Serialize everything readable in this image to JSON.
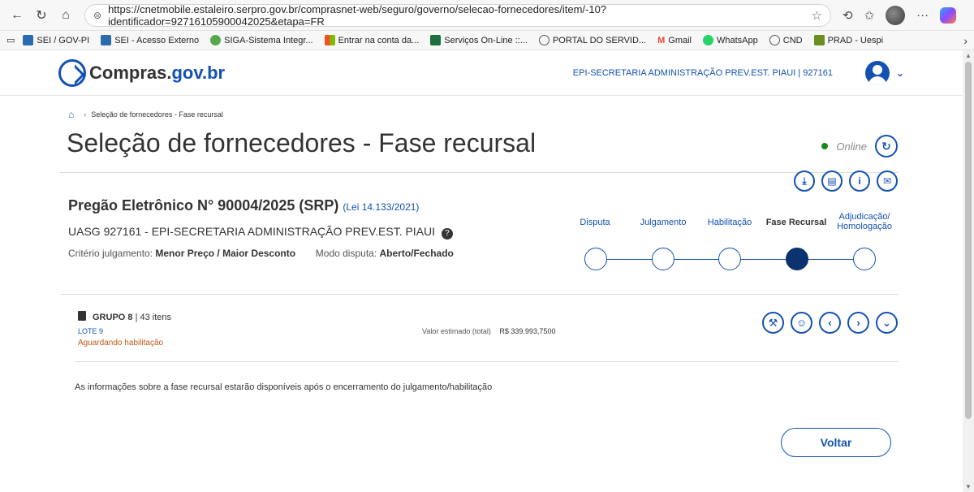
{
  "browser": {
    "url": "https://cnetmobile.estaleiro.serpro.gov.br/comprasnet-web/seguro/governo/selecao-fornecedores/item/-10?identificador=92716105900042025&etapa=FR",
    "bookmarks": [
      {
        "label": "SEI / GOV-PI",
        "color": "#2b6cb0"
      },
      {
        "label": "SEI - Acesso Externo",
        "color": "#2b6cb0"
      },
      {
        "label": "SIGA-Sistema Integr...",
        "color": "#56a84c"
      },
      {
        "label": "Entrar na conta da...",
        "color": "#f25022"
      },
      {
        "label": "Serviços On-Line ::...",
        "color": "#1f6e3d"
      },
      {
        "label": "PORTAL DO SERVID...",
        "color": "#555555"
      },
      {
        "label": "Gmail",
        "color": "#ea4335"
      },
      {
        "label": "WhatsApp",
        "color": "#25d366"
      },
      {
        "label": "CND",
        "color": "#555555"
      },
      {
        "label": "PRAD - Uespi",
        "color": "#6b8e23"
      }
    ]
  },
  "header": {
    "logo_main": "Compras.",
    "logo_gov": "gov.br",
    "org": "EPI-SECRETARIA ADMINISTRAÇÃO PREV.EST. PIAUI | 927161"
  },
  "breadcrumb": {
    "current": "Seleção de fornecedores - Fase recursal"
  },
  "page": {
    "title": "Seleção de fornecedores - Fase recursal",
    "status": "Online"
  },
  "licitacao": {
    "pregao": "Pregão Eletrônico N° 90004/2025 (SRP)",
    "lei": "(Lei 14.133/2021)",
    "uasg": "UASG 927161 - EPI-SECRETARIA ADMINISTRAÇÃO PREV.EST. PIAUI",
    "criterio_label": "Critério julgamento:",
    "criterio_value": "Menor Preço / Maior Desconto",
    "modo_label": "Modo disputa:",
    "modo_value": "Aberto/Fechado"
  },
  "steps": [
    {
      "label": "Disputa",
      "active": false
    },
    {
      "label": "Julgamento",
      "active": false
    },
    {
      "label": "Habilitação",
      "active": false
    },
    {
      "label": "Fase Recursal",
      "active": true
    },
    {
      "label": "Adjudicação/ Homologação",
      "active": false
    }
  ],
  "grupo": {
    "name": "GRUPO 8",
    "itens": "| 43 itens",
    "lote": "LOTE 9",
    "status": "Aguardando habilitação",
    "valor_label": "Valor estimado (total)",
    "valor": "R$ 339.993,7500"
  },
  "info": "As informações sobre a fase recursal estarão disponíveis após o encerramento do julgamento/habilitação",
  "voltar": "Voltar"
}
